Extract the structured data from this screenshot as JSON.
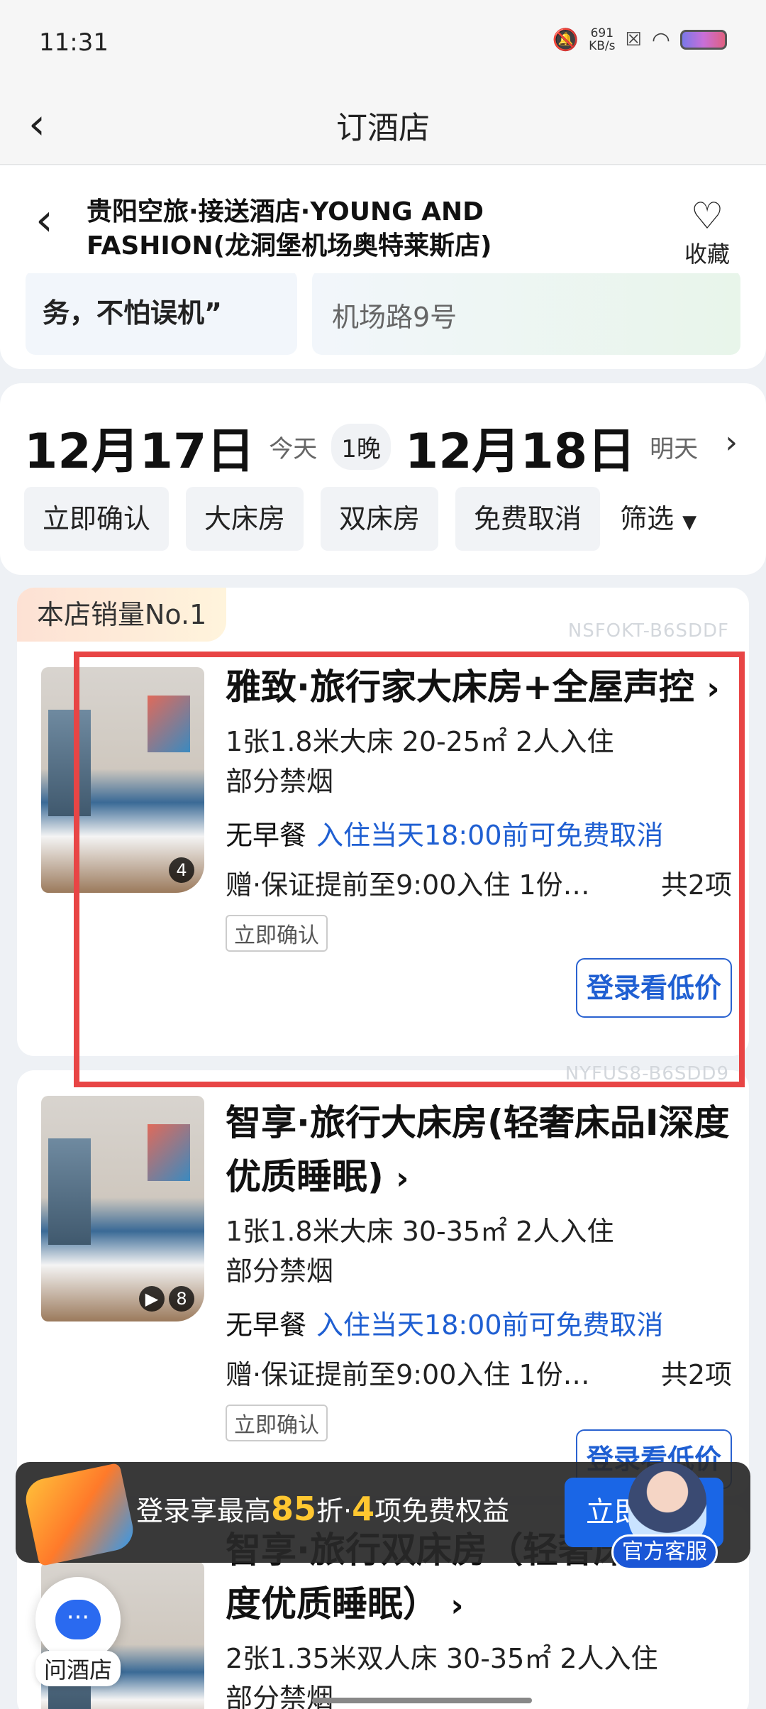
{
  "status_bar": {
    "time": "11:31",
    "speed_value": "691",
    "speed_unit": "KB/s"
  },
  "top_nav": {
    "back": "‹",
    "title": "订酒店"
  },
  "hotel": {
    "name_line1": "贵阳空旅·接送酒店·YOUNG AND",
    "name_line2": "FASHION(龙洞堡机场奥特莱斯店)",
    "fav_label": "收藏",
    "info_left": "务，不怕误机”",
    "info_right": "机场路9号"
  },
  "dates": {
    "checkin": "12月17日",
    "checkin_sub": "今天",
    "nights": "1晚",
    "checkout": "12月18日",
    "checkout_sub": "明天"
  },
  "filters": [
    "立即确认",
    "大床房",
    "双床房",
    "免费取消",
    "筛选"
  ],
  "rooms": [
    {
      "badge": "本店销量No.1",
      "code": "NSFOKT-B6SDDF",
      "title": "雅致·旅行家大床房+全屋声控",
      "spec_line1": "1张1.8米大床  20-25㎡  2人入住",
      "spec_line2": "部分禁烟",
      "breakfast": "无早餐",
      "cancel": "入住当天18:00前可免费取消",
      "gift": "赠·保证提前至9:00入住 1份…",
      "gift_count": "共2项",
      "tag": "立即确认",
      "cta": "登录看低价",
      "photo_count": "4"
    },
    {
      "code": "NYFUS8-B6SDD9",
      "title": "智享·旅行大床房(轻奢床品I深度优质睡眠)",
      "spec_line1": "1张1.8米大床  30-35㎡  2人入住",
      "spec_line2": "部分禁烟",
      "breakfast": "无早餐",
      "cancel": "入住当天18:00前可免费取消",
      "gift": "赠·保证提前至9:00入住 1份…",
      "gift_count": "共2项",
      "tag": "立即确认",
      "cta": "登录看低价",
      "photo_count": "8"
    },
    {
      "title": "智享·旅行双床房（轻奢床品I深度优质睡眠）",
      "spec_line1": "2张1.35米双人床  30-35㎡  2人入住",
      "spec_line2": "部分禁烟"
    }
  ],
  "promo": {
    "text_a": "登录享最高",
    "discount": "85",
    "text_b": "折·",
    "benefit_count": "4",
    "text_c": "项免费权益",
    "cta": "立即"
  },
  "service_label": "官方客服",
  "ask_label": "问酒店",
  "colors": {
    "accent_blue": "#1f5fd2",
    "highlight_red": "#e84545",
    "promo_gold": "#ffc730"
  }
}
